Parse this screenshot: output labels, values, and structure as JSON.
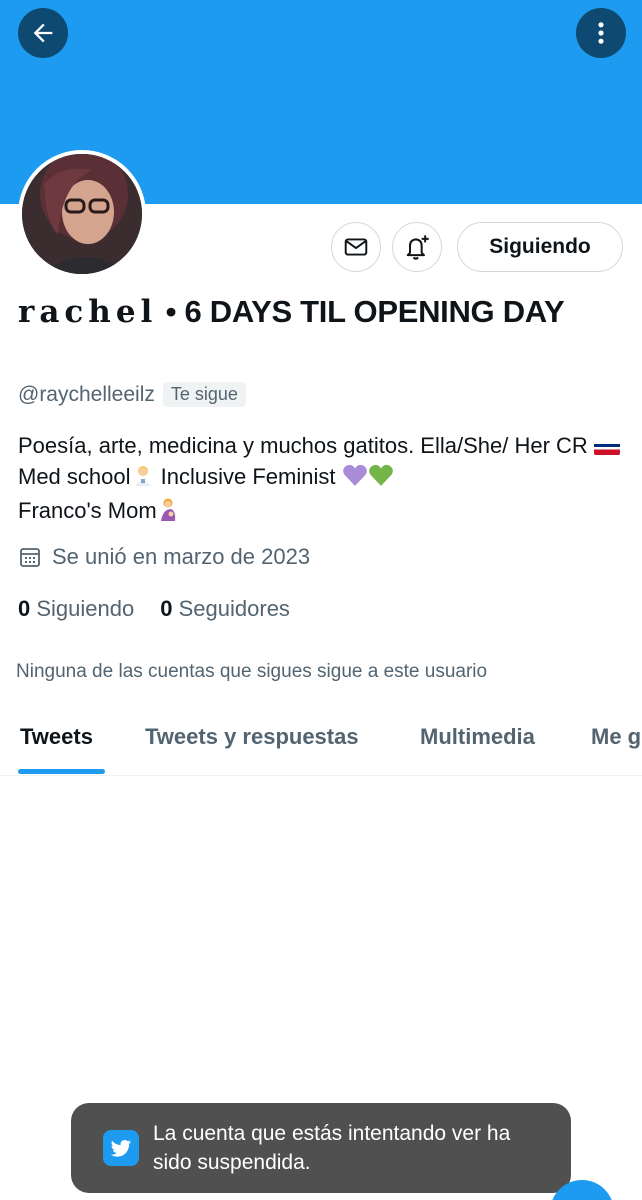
{
  "profile": {
    "name_fancy": "𝐫𝐚𝐜𝐡𝐞𝐥",
    "name_rest": " • 6 DAYS TIL OPENING DAY",
    "handle": "@raychelleeilz",
    "follows_you": "Te sigue",
    "follow_button": "Siguiendo",
    "bio": {
      "part1": "Poesía, arte, medicina y muchos gatitos. Ella/She/ Her CR ",
      "part2": " Med school",
      "part3": " Inclusive Feminist ",
      "part4": " Franco's Mom"
    },
    "joined": "Se unió en marzo de 2023",
    "following_count": "0",
    "following_label": "Siguiendo",
    "followers_count": "0",
    "followers_label": "Seguidores",
    "mutual_text": "Ninguna de las cuentas que sigues sigue a este usuario"
  },
  "tabs": [
    {
      "label": "Tweets"
    },
    {
      "label": "Tweets y respuestas"
    },
    {
      "label": "Multimedia"
    },
    {
      "label": "Me g"
    }
  ],
  "toast": {
    "text": "La cuenta que estás intentando ver ha sido suspendida."
  },
  "colors": {
    "accent": "#1d9bf0",
    "banner_button": "#0d4970",
    "toast_bg": "#505050"
  },
  "icons": [
    "back-arrow-icon",
    "more-vertical-icon",
    "mail-icon",
    "bell-plus-icon",
    "calendar-icon",
    "twitter-bird-icon"
  ]
}
